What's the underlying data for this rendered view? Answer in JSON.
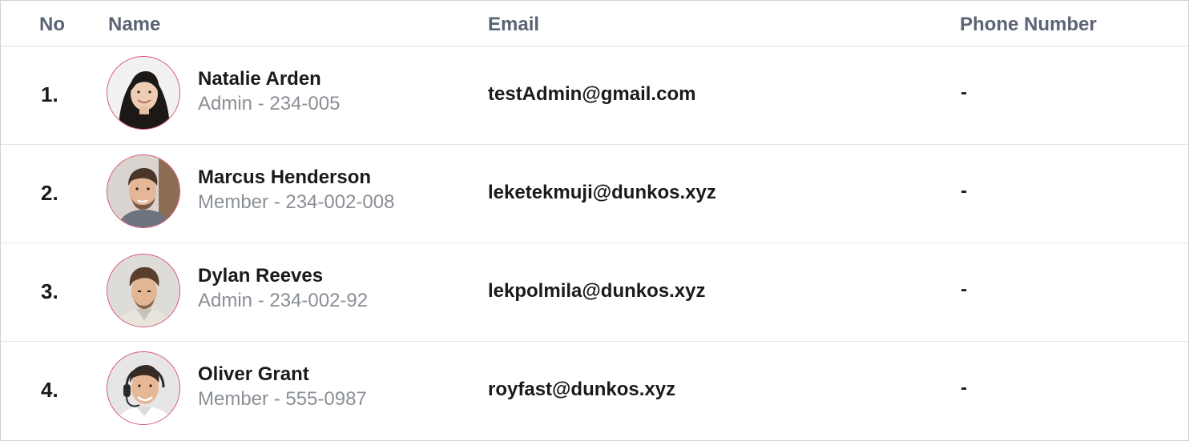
{
  "header": {
    "no": "No",
    "name": "Name",
    "email": "Email",
    "phone": "Phone Number"
  },
  "rows": [
    {
      "no": "1.",
      "name": "Natalie Arden",
      "subtitle": "Admin - 234-005",
      "email": "testAdmin@gmail.com",
      "phone": "-"
    },
    {
      "no": "2.",
      "name": "Marcus Henderson",
      "subtitle": "Member - 234-002-008",
      "email": "leketekmuji@dunkos.xyz",
      "phone": "-"
    },
    {
      "no": "3.",
      "name": "Dylan Reeves",
      "subtitle": "Admin - 234-002-92",
      "email": "lekpolmila@dunkos.xyz",
      "phone": "-"
    },
    {
      "no": "4.",
      "name": "Oliver Grant",
      "subtitle": "Member - 555-0987",
      "email": "royfast@dunkos.xyz",
      "phone": "-"
    }
  ],
  "colors": {
    "header_text": "#5a6474",
    "avatar_ring": "#d44a68",
    "subtitle_text": "#8a8f96"
  }
}
